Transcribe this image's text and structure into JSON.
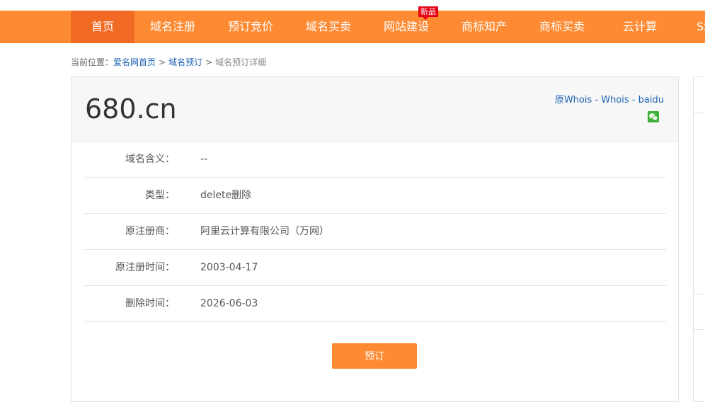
{
  "nav": {
    "items": [
      {
        "label": "首页",
        "active": true
      },
      {
        "label": "域名注册"
      },
      {
        "label": "预订竞价"
      },
      {
        "label": "域名买卖"
      },
      {
        "label": "网站建设",
        "badge": "新品"
      },
      {
        "label": "商标知产"
      },
      {
        "label": "商标买卖"
      },
      {
        "label": "云计算"
      },
      {
        "label": "SS"
      }
    ],
    "accent_color": "#fe8b33",
    "active_color": "#f16a24"
  },
  "breadcrumb": {
    "prefix": "当前位置：",
    "home": "爱名网首页",
    "section": "域名预订",
    "current": "域名预订详细",
    "separator": ">"
  },
  "domain": {
    "name": "680.cn",
    "links": {
      "original_whois": "原Whois",
      "whois": "Whois",
      "baidu": "baidu",
      "separator": "-"
    },
    "share_icon": "wechat-icon"
  },
  "details": [
    {
      "label": "域名含义：",
      "value": "--"
    },
    {
      "label": "类型：",
      "value": "delete删除"
    },
    {
      "label": "原注册商：",
      "value": "阿里云计算有限公司（万网）"
    },
    {
      "label": "原注册时间：",
      "value": "2003-04-17"
    },
    {
      "label": "删除时间：",
      "value": "2026-06-03"
    }
  ],
  "actions": {
    "reserve_label": "预订"
  }
}
